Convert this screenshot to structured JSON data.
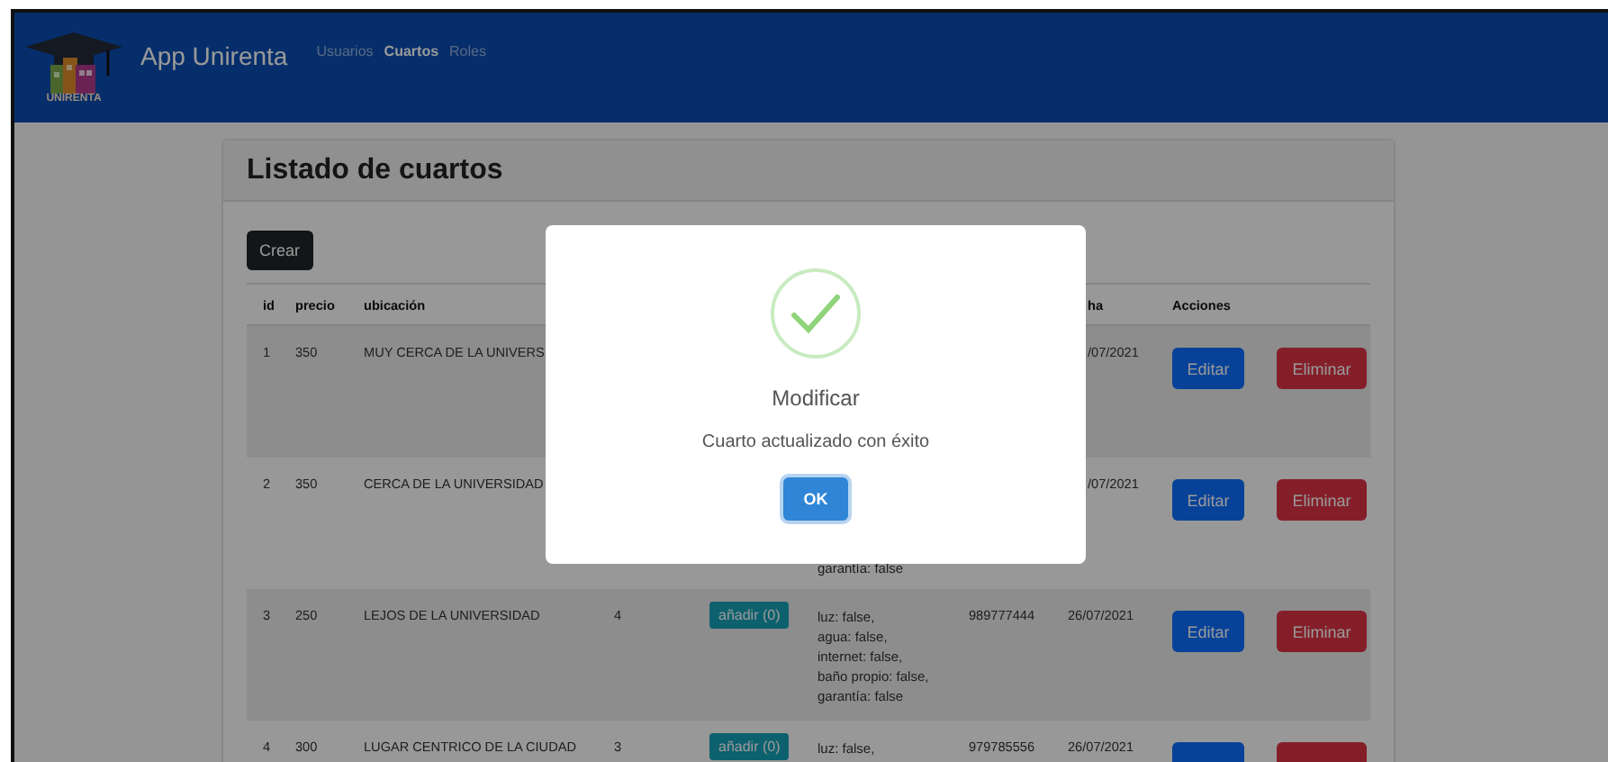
{
  "navbar": {
    "logo_text": "UNIRENTA",
    "brand": "App Unirenta",
    "links": [
      {
        "label": "Usuarios",
        "selected": false
      },
      {
        "label": "Cuartos",
        "selected": true
      },
      {
        "label": "Roles",
        "selected": false
      }
    ]
  },
  "card": {
    "title": "Listado de cuartos",
    "create_button": "Crear"
  },
  "table": {
    "headers": {
      "id": "id",
      "price": "precio",
      "location": "ubicación",
      "date": "ha",
      "actions": "Acciones"
    },
    "rows": [
      {
        "id": "1",
        "price": "350",
        "location": "MUY CERCA DE LA UNIVERS",
        "date": "/07/2021",
        "edit_button": "Editar",
        "delete_button": "Eliminar"
      },
      {
        "id": "2",
        "price": "350",
        "location": "CERCA DE LA UNIVERSIDAD",
        "services": [
          "garantía: false"
        ],
        "date": "/07/2021",
        "edit_button": "Editar",
        "delete_button": "Eliminar"
      },
      {
        "id": "3",
        "price": "250",
        "location": "LEJOS DE LA UNIVERSIDAD",
        "rooms": "4",
        "add_button": "añadir (0)",
        "services": [
          "luz: false,",
          "agua: false,",
          "internet: false,",
          "baño propio: false,",
          "garantía: false"
        ],
        "phone": "989777444",
        "date": "26/07/2021",
        "edit_button": "Editar",
        "delete_button": "Eliminar"
      },
      {
        "id": "4",
        "price": "300",
        "location": "LUGAR CENTRICO DE LA CIUDAD",
        "rooms": "3",
        "add_button": "añadir (0)",
        "services": [
          "luz: false,"
        ],
        "phone": "979785556",
        "date": "26/07/2021"
      }
    ]
  },
  "modal": {
    "kind": "success",
    "title": "Modificar",
    "text": "Cuarto actualizado con éxito",
    "confirm_button": "OK"
  }
}
